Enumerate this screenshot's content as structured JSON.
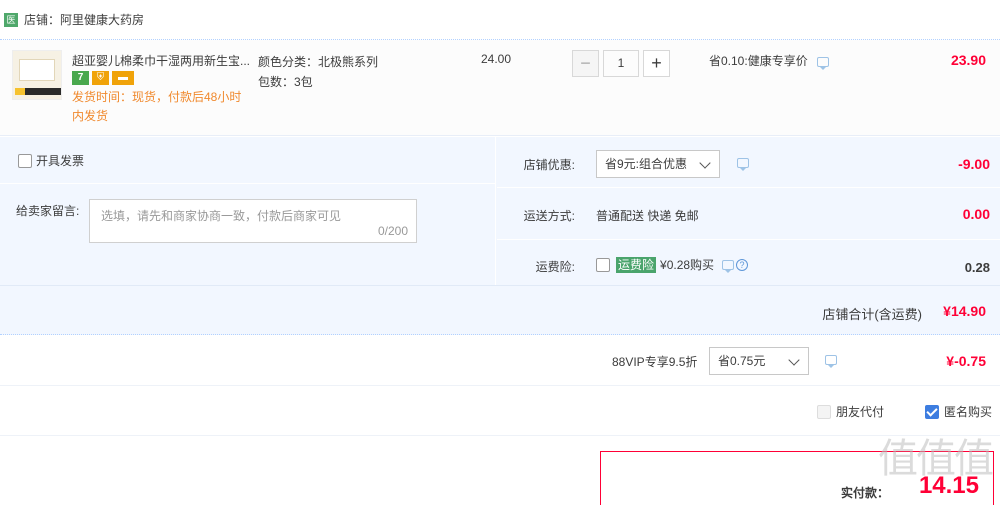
{
  "shop": {
    "icon_text": "医",
    "label": "店铺：阿里健康大药房"
  },
  "item": {
    "title": "超亚婴儿棉柔巾干湿两用新生宝...",
    "badges": [
      "7",
      "",
      ""
    ],
    "ship_time": "发货时间：现货，付款后48小时内发货",
    "sku_color": "颜色分类：北极熊系列",
    "sku_count": "包数：3包",
    "unit_price": "24.00",
    "quantity": "1",
    "promo": "省0.10:健康专享价",
    "total": "23.90"
  },
  "invoice": {
    "label": "开具发票"
  },
  "message": {
    "label": "给卖家留言:",
    "placeholder": "选填，请先和商家协商一致，付款后商家可见",
    "count": "0/200"
  },
  "discount": {
    "label": "店铺优惠:",
    "selected": "省9元:组合优惠",
    "value": "-9.00"
  },
  "shipping": {
    "label": "运送方式:",
    "text": "普通配送 快递 免邮",
    "value": "0.00"
  },
  "insurance": {
    "label": "运费险:",
    "tag": "运费险",
    "text": "¥0.28购买",
    "value": "0.28"
  },
  "shop_total": {
    "label": "店铺合计(含运费)",
    "value": "¥14.90"
  },
  "vip": {
    "label": "88VIP专享9.5折",
    "selected": "省0.75元",
    "value": "¥-0.75"
  },
  "options": {
    "friend_pay": "朋友代付",
    "anonymous": "匿名购买"
  },
  "payment": {
    "label": "实付款：",
    "value": "14.15"
  },
  "watermark": "值值值"
}
